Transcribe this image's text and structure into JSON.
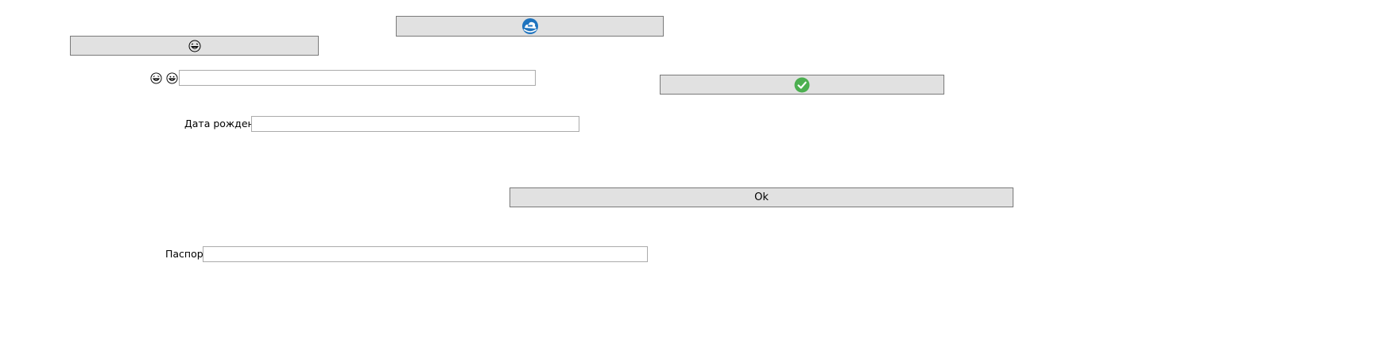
{
  "buttons": {
    "top_logo_button": {
      "icon": "cloud-logo-icon",
      "color": "#1e73be"
    },
    "emoji_button": {
      "icon": "laughing-face-icon"
    },
    "confirm_button": {
      "icon": "green-check-icon",
      "color": "#4caf50"
    },
    "ok_button": {
      "label": "Ok"
    }
  },
  "form": {
    "emoji_row": {
      "icons": [
        "laughing-face-icon",
        "grinning-face-icon"
      ],
      "value": ""
    },
    "birth_date": {
      "label": "Дата рождения",
      "value": ""
    },
    "passport": {
      "label": "Паспорт",
      "value": ""
    }
  },
  "colors": {
    "button_bg": "#e1e1e1",
    "button_border": "#7a7a7a",
    "field_border": "#ababab"
  }
}
